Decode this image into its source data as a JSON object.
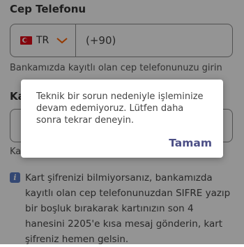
{
  "phone": {
    "label": "Cep Telefonu",
    "country_code": "TR",
    "prefix": "(+90)",
    "hint": "Bankamızda kayıtlı olan cep telefonunuzu girin"
  },
  "card": {
    "label_partial": "Ka",
    "hint_partial": "Ka"
  },
  "info": {
    "text": "Kart şifrenizi bilmiyorsanız, bankamızda kayıtlı olan cep telefonunuzdan SIFRE yazıp bir boşluk bırakarak kartınızın son 4 hanesini 2205'e kısa mesaj gönderin, kart şifreniz hemen gelsin."
  },
  "dialog": {
    "message": "Teknik bir sorun nedeniyle işleminize devam edemiyoruz. Lütfen daha sonra tekrar deneyin.",
    "button": "Tamam"
  },
  "colors": {
    "accent": "#4c4f86",
    "chevron": "#ff6200",
    "info_icon": "#5a7cc6"
  }
}
